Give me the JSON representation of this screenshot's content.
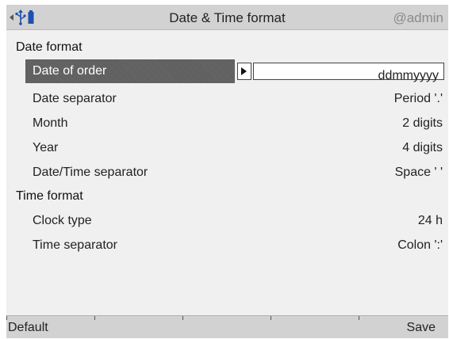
{
  "header": {
    "title": "Date & Time format",
    "user": "@admin",
    "icons": [
      "arrow-left-icon",
      "usb-icon",
      "device-icon"
    ]
  },
  "sections": [
    {
      "title": "Date format",
      "items": [
        {
          "label": "Date of order",
          "value": "ddmmyyyy",
          "selected": true
        },
        {
          "label": "Date separator",
          "value": "Period '.'"
        },
        {
          "label": "Month",
          "value": "2 digits"
        },
        {
          "label": "Year",
          "value": "4 digits"
        },
        {
          "label": "Date/Time separator",
          "value": "Space ' '"
        }
      ]
    },
    {
      "title": "Time format",
      "items": [
        {
          "label": "Clock type",
          "value": "24 h"
        },
        {
          "label": "Time separator",
          "value": "Colon ':'"
        }
      ]
    }
  ],
  "footer": {
    "softkeys": [
      "Default",
      "",
      "",
      "",
      "Save"
    ]
  },
  "colors": {
    "titlebar": "#d2d2d2",
    "background": "#f0f0f0",
    "selection": "#5f5f5f",
    "user_text": "#8a8a8a"
  }
}
